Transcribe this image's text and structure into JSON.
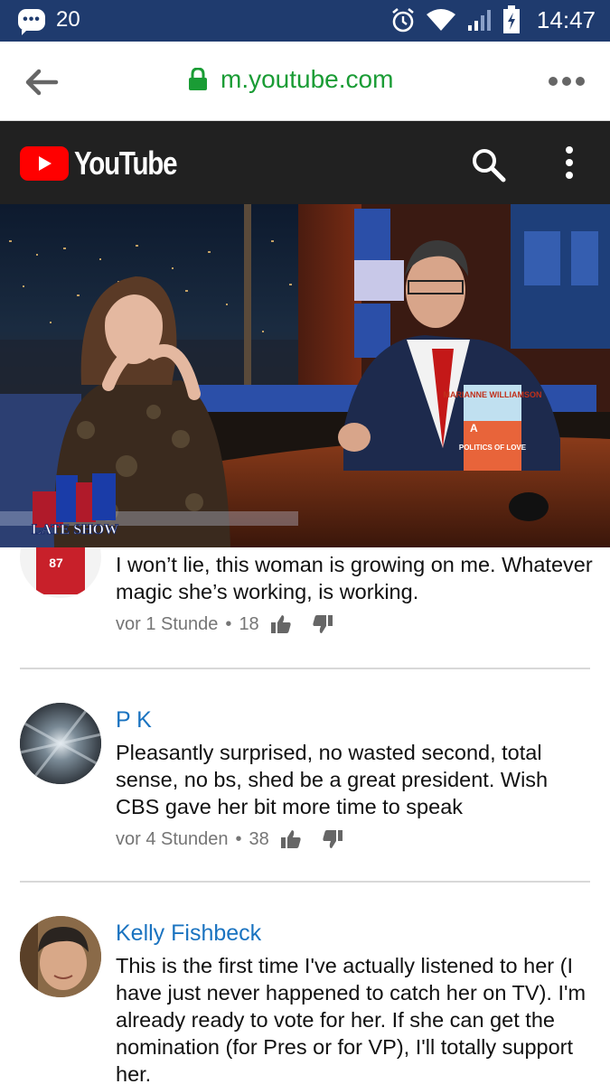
{
  "status_bar": {
    "notification_count": "20",
    "time": "14:47"
  },
  "browser": {
    "url": "m.youtube.com"
  },
  "youtube": {
    "logo_text": "YouTube"
  },
  "video": {
    "overlay_show": "LATE SHOW",
    "book_author": "MARIANNE WILLIAMSON",
    "book_title_a": "A",
    "book_title_b": "POLITICS OF LOVE"
  },
  "comments": [
    {
      "author": "",
      "avatar_label": "87",
      "text": "I won’t lie, this woman is growing on me. Whatever magic she’s working, is working.",
      "time": "vor 1 Stunde",
      "likes": "18"
    },
    {
      "author": "P K",
      "text": "Pleasantly surprised, no wasted second, total sense, no bs, shed be a great president. Wish CBS gave her bit more time to speak",
      "time": "vor 4 Stunden",
      "likes": "38"
    },
    {
      "author": "Kelly Fishbeck",
      "text": "This is the first time I've actually listened to her (I have just never happened to catch her on TV). I'm already ready to vote for her. If she can get the nomination (for Pres or for VP), I'll totally support her.",
      "time": "",
      "likes": ""
    }
  ],
  "colors": {
    "status_bar": "#1f3b6e",
    "url_green": "#1a9c35",
    "yt_header": "#212121",
    "yt_red": "#ff0000",
    "author_blue": "#1a73c0",
    "meta_gray": "#757575"
  }
}
